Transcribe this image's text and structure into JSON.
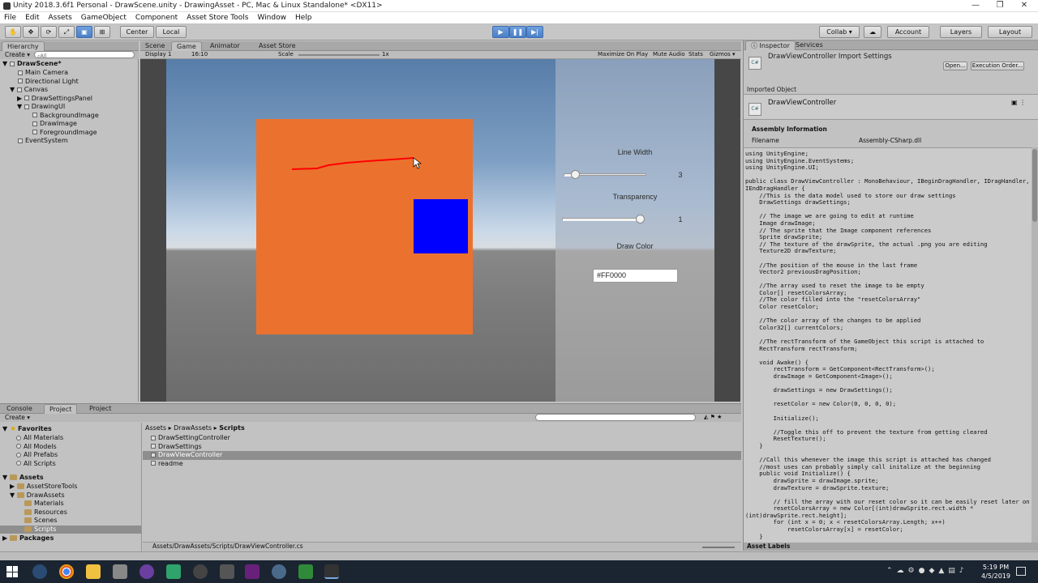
{
  "window": {
    "title": "Unity 2018.3.6f1 Personal - DrawScene.unity - DrawingAsset - PC, Mac & Linux Standalone* <DX11>",
    "minimize": "—",
    "maximize": "❐",
    "close": "✕"
  },
  "menu": [
    "File",
    "Edit",
    "Assets",
    "GameObject",
    "Component",
    "Asset Store Tools",
    "Window",
    "Help"
  ],
  "toolbar": {
    "pivot": "Center",
    "space": "Local",
    "collab": "Collab ▾",
    "account": "Account",
    "layers": "Layers",
    "layout": "Layout"
  },
  "hierarchy": {
    "tab": "Hierarchy",
    "create": "Create ▾",
    "search_placeholder": "All",
    "scene": "DrawScene*",
    "items": [
      "Main Camera",
      "Directional Light",
      "Canvas",
      "DrawSettingsPanel",
      "DrawingUI",
      "BackgroundImage",
      "DrawImage",
      "ForegroundImage",
      "EventSystem"
    ]
  },
  "center_tabs": [
    "Scene",
    "Game",
    "Animator",
    "Asset Store"
  ],
  "game_bar": {
    "display": "Display 1",
    "aspect": "16:10",
    "scale_label": "Scale",
    "scale_value": "1x",
    "maximize": "Maximize On Play",
    "mute": "Mute Audio",
    "stats": "Stats",
    "gizmos": "Gizmos ▾"
  },
  "game_ui": {
    "line_width_label": "Line Width",
    "line_width_value": "3",
    "line_width_fraction": 0.1,
    "transparency_label": "Transparency",
    "transparency_value": "1",
    "transparency_fraction": 1.0,
    "draw_color_label": "Draw Color",
    "draw_color_value": "#FF0000"
  },
  "colors": {
    "canvas": "#eb722e",
    "square": "#0000ff",
    "stroke": "#ff0000"
  },
  "inspector": {
    "tabs": [
      "Inspector",
      "Services"
    ],
    "header": "DrawViewController Import Settings",
    "open": "Open...",
    "exec_order": "Execution Order...",
    "imported_object": "Imported Object",
    "object_name": "DrawViewController",
    "assembly_info": "Assembly Information",
    "filename_label": "Filename",
    "filename_value": "Assembly-CSharp.dll",
    "asset_labels": "Asset Labels",
    "code": "using UnityEngine;\nusing UnityEngine.EventSystems;\nusing UnityEngine.UI;\n\npublic class DrawViewController : MonoBehaviour, IBeginDragHandler, IDragHandler,\nIEndDragHandler {\n    //This is the data model used to store our draw settings\n    DrawSettings drawSettings;\n\n    // The image we are going to edit at runtime\n    Image drawImage;\n    // The sprite that the Image component references\n    Sprite drawSprite;\n    // The texture of the drawSprite, the actual .png you are editing\n    Texture2D drawTexture;\n\n    //The position of the mouse in the last frame\n    Vector2 previousDragPosition;\n\n    //The array used to reset the image to be empty\n    Color[] resetColorsArray;\n    //The color filled into the \"resetColorsArray\"\n    Color resetColor;\n\n    //The color array of the changes to be applied\n    Color32[] currentColors;\n\n    //The rectTransform of the GameObject this script is attached to\n    RectTransform rectTransform;\n\n    void Awake() {\n        rectTransform = GetComponent<RectTransform>();\n        drawImage = GetComponent<Image>();\n\n        drawSettings = new DrawSettings();\n\n        resetColor = new Color(0, 0, 0, 0);\n\n        Initialize();\n\n        //Toggle this off to prevent the texture from getting cleared\n        ResetTexture();\n    }\n\n    //Call this whenever the image this script is attached has changed\n    //most uses can probably simply call initalize at the beginning\n    public void Initialize() {\n        drawSprite = drawImage.sprite;\n        drawTexture = drawSprite.texture;\n\n        // fill the array with our reset color so it can be easily reset later on\n        resetColorsArray = new Color[(int)drawSprite.rect.width *\n(int)drawSprite.rect.height];\n        for (int x = 0; x < resetColorsArray.Length; x++)\n            resetColorsArray[x] = resetColor;\n    }"
  },
  "project": {
    "tabs": [
      "Console",
      "Project",
      "Project"
    ],
    "create": "Create ▾",
    "favorites": "Favorites",
    "fav_items": [
      "All Materials",
      "All Models",
      "All Prefabs",
      "All Scripts"
    ],
    "assets": "Assets",
    "asset_tree": [
      "AssetStoreTools",
      "DrawAssets",
      "Materials",
      "Resources",
      "Scenes",
      "Scripts"
    ],
    "packages": "Packages",
    "breadcrumb": [
      "Assets",
      "DrawAssets",
      "Scripts"
    ],
    "files": [
      "DrawSettingController",
      "DrawSettings",
      "DrawViewController",
      "readme"
    ],
    "path": "Assets/DrawAssets/Scripts/DrawViewController.cs"
  },
  "taskbar": {
    "time": "5:19 PM",
    "date": "4/5/2019"
  }
}
